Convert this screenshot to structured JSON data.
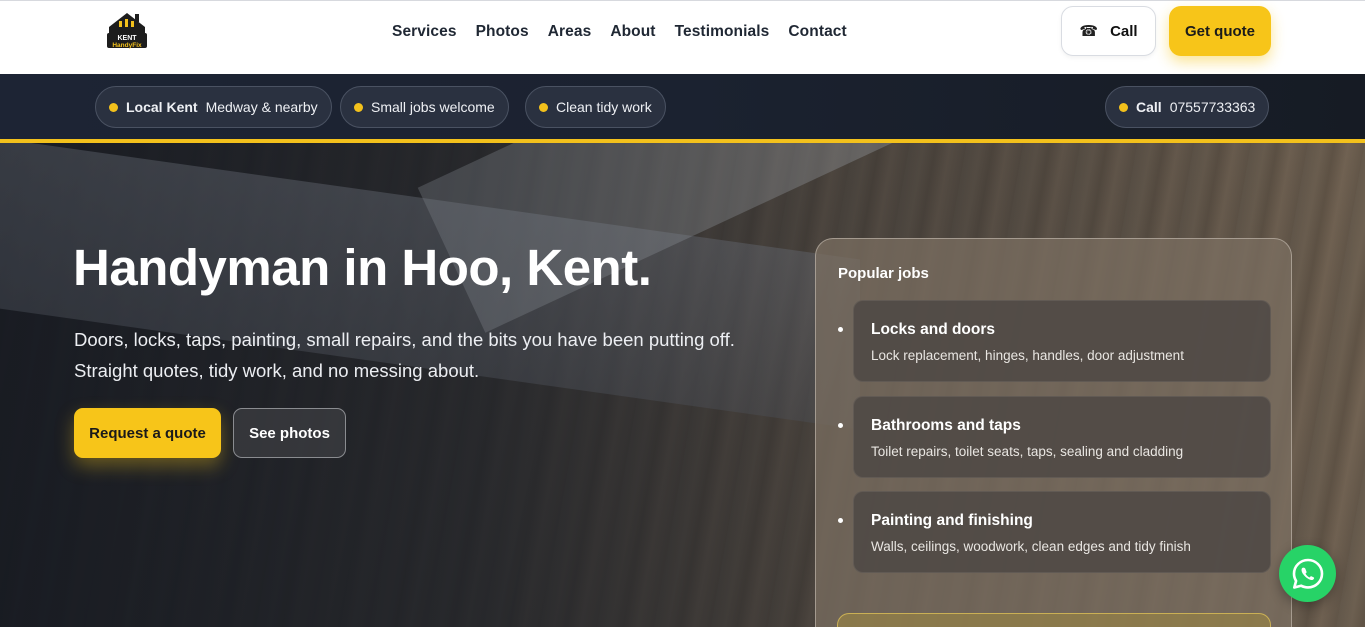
{
  "logo": {
    "line1": "KENT",
    "line2": "HandyFix"
  },
  "nav": {
    "items": [
      {
        "label": "Services"
      },
      {
        "label": "Photos"
      },
      {
        "label": "Areas"
      },
      {
        "label": "About"
      },
      {
        "label": "Testimonials"
      },
      {
        "label": "Contact"
      }
    ]
  },
  "header": {
    "call_icon": "☎",
    "call_label": "Call",
    "quote_label": "Get quote"
  },
  "strip": {
    "pill1_bold": "Local Kent",
    "pill1_text": "Medway & nearby",
    "pill2_text": "Small jobs welcome",
    "pill3_text": "Clean tidy work",
    "phone_bold": "Call",
    "phone_number": "07557733363"
  },
  "hero": {
    "title": "Handyman in Hoo, Kent.",
    "subtitle_line1": "Doors, locks, taps, painting, small repairs, and the bits you have been putting off.",
    "subtitle_line2": "Straight quotes, tidy work, and no messing about.",
    "request_label": "Request a quote",
    "photos_label": "See photos"
  },
  "popular": {
    "title": "Popular jobs",
    "jobs": [
      {
        "title": "Locks and doors",
        "desc": "Lock replacement, hinges, handles, door adjustment"
      },
      {
        "title": "Bathrooms and taps",
        "desc": "Toilet repairs, toilet seats, taps, sealing and cladding"
      },
      {
        "title": "Painting and finishing",
        "desc": "Walls, ceilings, woodwork, clean edges and tidy finish"
      }
    ]
  },
  "colors": {
    "accent": "#f7c519",
    "dark": "#1d2434",
    "whatsapp": "#27d367"
  }
}
